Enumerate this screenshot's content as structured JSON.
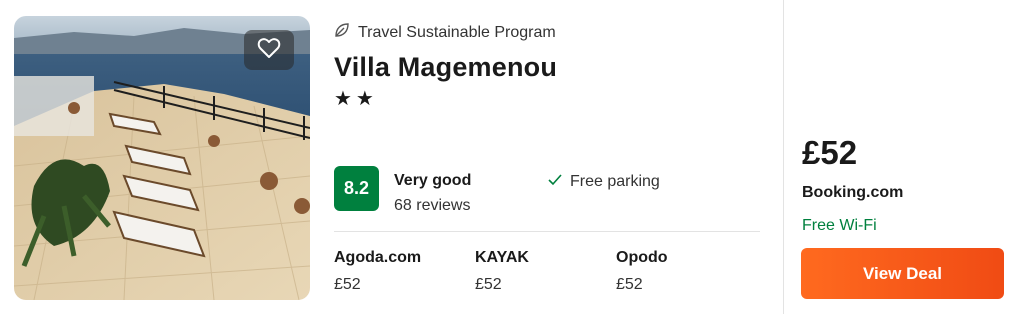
{
  "listing": {
    "program": "Travel Sustainable Program",
    "program_icon": "leaf-icon",
    "name": "Villa Magemenou",
    "stars": "★★",
    "star_rating": 2,
    "favorite_icon": "heart-icon",
    "rating": {
      "score": "8.2",
      "label": "Very good",
      "reviews": "68 reviews",
      "badge_color": "#00803e"
    },
    "amenity": {
      "icon": "check-icon",
      "label": "Free parking"
    },
    "providers": [
      {
        "name": "Agoda.com",
        "price": "£52"
      },
      {
        "name": "KAYAK",
        "price": "£52"
      },
      {
        "name": "Opodo",
        "price": "£52"
      }
    ]
  },
  "deal": {
    "price": "£52",
    "provider": "Booking.com",
    "amenity": "Free Wi-Fi",
    "amenity_color": "#00803e",
    "button_label": "View Deal",
    "button_color": "#ff5a1a"
  }
}
